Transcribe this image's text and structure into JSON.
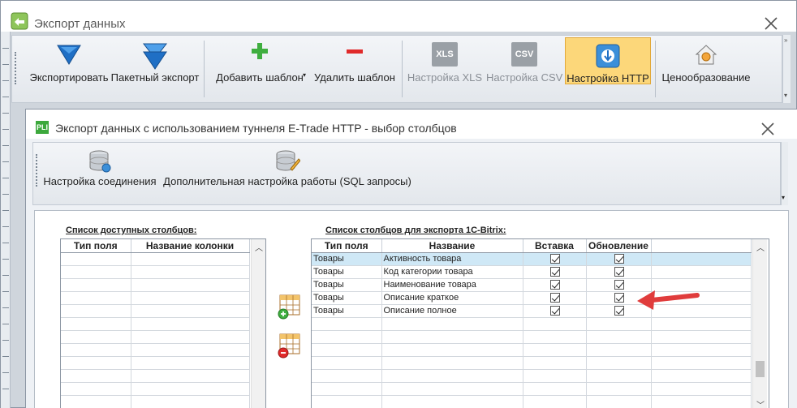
{
  "window": {
    "title": "Экспорт данных"
  },
  "toolbar": {
    "export_label": "Экспортировать",
    "batch_export_label": "Пакетный экспорт",
    "add_template_label": "Добавить шаблон",
    "delete_template_label": "Удалить шаблон",
    "xls_settings_label": "Настройка XLS",
    "csv_settings_label": "Настройка CSV",
    "http_settings_label": "Настройка HTTP",
    "pricing_label": "Ценообразование",
    "xls_icon_text": "XLS",
    "csv_icon_text": "CSV"
  },
  "dialog": {
    "title": "Экспорт данных с использованием туннеля E-Trade HTTP - выбор столбцов",
    "icon_text": "PLI",
    "connection_settings_label": "Настройка соединения",
    "advanced_settings_label": "Дополнительная настройка работы (SQL запросы)",
    "available": {
      "label": "Список доступных столбцов:",
      "headers": [
        "Тип поля",
        "Название колонки"
      ]
    },
    "export": {
      "label": "Список столбцов для экспорта 1С-Bitrix:",
      "headers": [
        "Тип поля",
        "Название",
        "Вставка",
        "Обновление"
      ],
      "rows": [
        {
          "type": "Товары",
          "name": "Активность товара",
          "insert": true,
          "update": true
        },
        {
          "type": "Товары",
          "name": "Код категории товара",
          "insert": true,
          "update": true
        },
        {
          "type": "Товары",
          "name": "Наименование товара",
          "insert": true,
          "update": true
        },
        {
          "type": "Товары",
          "name": "Описание краткое",
          "insert": true,
          "update": true
        },
        {
          "type": "Товары",
          "name": "Описание полное",
          "insert": true,
          "update": true
        }
      ]
    }
  },
  "colors": {
    "accent_active": "#fcd77a",
    "selected_row": "#cfe8f6",
    "arrow": "#e03c3c"
  }
}
